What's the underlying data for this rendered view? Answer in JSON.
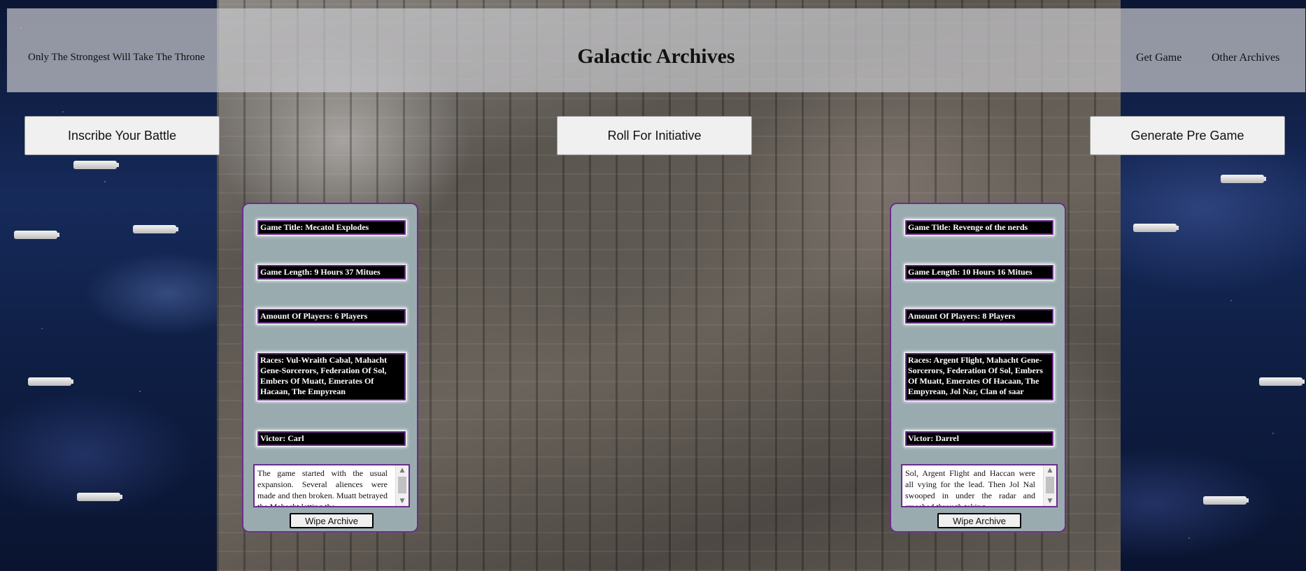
{
  "header": {
    "tagline": "Only The Strongest Will Take The Throne",
    "title": "Galactic Archives",
    "nav": {
      "get_game": "Get Game",
      "other_archives": "Other Archives"
    }
  },
  "actions": {
    "inscribe": "Inscribe Your Battle",
    "roll": "Roll For Initiative",
    "generate": "Generate Pre Game"
  },
  "archives": [
    {
      "title": "Game Title: Mecatol Explodes",
      "length": "Game Length: 9 Hours 37 Mitues",
      "players": "Amount Of Players: 6 Players",
      "races": "Races: Vul-Wraith Cabal, Mahacht Gene-Sorcerors, Federation Of Sol, Embers Of Muatt, Emerates Of Hacaan, The Empyrean",
      "victor": "Victor: Carl",
      "summary": "The game started with the usual expansion. Several aliences were made and then broken. Muatt betrayed the Mahacht letting the",
      "wipe_label": "Wipe Archive"
    },
    {
      "title": "Game Title: Revenge of the nerds",
      "length": "Game Length: 10 Hours 16 Mitues",
      "players": "Amount Of Players: 8 Players",
      "races": "Races: Argent Flight, Mahacht Gene-Sorcerors, Federation Of Sol, Embers Of Muatt, Emerates Of Hacaan, The Empyrean, Jol Nar, Clan of saar",
      "victor": "Victor: Darrel",
      "summary": "Sol, Argent Flight and Haccan were all vying for the lead. Then Jol Nal swooped in under the radar and smashed through taking",
      "wipe_label": "Wipe Archive"
    }
  ],
  "icons": {
    "scroll_up": "▲",
    "scroll_down": "▼"
  },
  "colors": {
    "card_border": "#6c2c8c",
    "card_bg": "#9aabb0",
    "header_bg": "#c8c8cc"
  }
}
